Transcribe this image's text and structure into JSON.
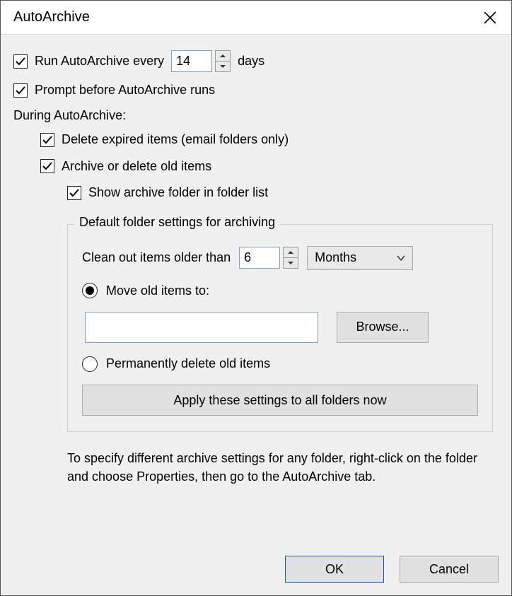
{
  "title": "AutoArchive",
  "runEvery": {
    "label_before": "Run AutoArchive every",
    "value": "14",
    "label_after": "days",
    "checked": true
  },
  "prompt": {
    "label": "Prompt before AutoArchive runs",
    "checked": true
  },
  "duringLabel": "During AutoArchive:",
  "deleteExpired": {
    "label": "Delete expired items (email folders only)",
    "checked": true
  },
  "archiveOld": {
    "label": "Archive or delete old items",
    "checked": true
  },
  "showFolder": {
    "label": "Show archive folder in folder list",
    "checked": true
  },
  "group": {
    "legend": "Default folder settings for archiving",
    "cleanOut": {
      "label": "Clean out items older than",
      "value": "6",
      "unit": "Months"
    },
    "moveOld": {
      "label": "Move old items to:",
      "selected": true,
      "path": ""
    },
    "browse": "Browse...",
    "permDelete": {
      "label": "Permanently delete old items",
      "selected": false
    },
    "applyAll": "Apply these settings to all folders now"
  },
  "helpText": "To specify different archive settings for any folder, right-click on the folder and choose Properties, then go to the AutoArchive tab.",
  "ok": "OK",
  "cancel": "Cancel"
}
